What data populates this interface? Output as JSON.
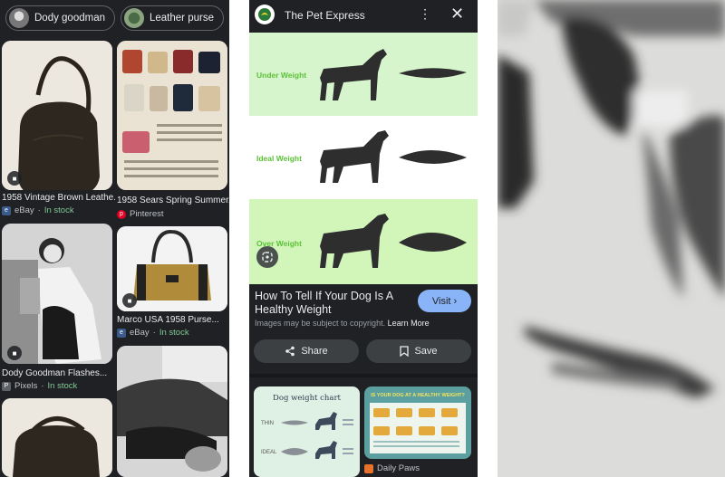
{
  "left_panel": {
    "chips": [
      {
        "label": "Dody goodman"
      },
      {
        "label": "Leather purse"
      },
      {
        "label": ""
      }
    ],
    "results": [
      {
        "caption": "1958 Vintage Brown Leathe...",
        "source": "eBay",
        "stock": "In stock"
      },
      {
        "caption": "1958 Sears Spring Summer...",
        "source": "Pinterest",
        "stock": ""
      },
      {
        "caption": "Marco USA 1958 Purse...",
        "source": "eBay",
        "stock": "In stock"
      },
      {
        "caption": "Dody Goodman Flashes...",
        "source": "Pixels",
        "stock": "In stock"
      }
    ],
    "separator": "·"
  },
  "middle_panel": {
    "header": {
      "title": "The Pet Express",
      "menu_icon": "kebab-icon",
      "close_icon": "close-icon"
    },
    "chart_labels": [
      "Under Weight",
      "Ideal Weight",
      "Over Weight"
    ],
    "image_title": "How To Tell If Your Dog Is A Healthy Weight",
    "visit_label": "Visit",
    "copyright_text": "Images may be subject to copyright.",
    "learn_more": "Learn More",
    "share_label": "Share",
    "save_label": "Save",
    "related": [
      {
        "title": "Dog weight chart",
        "rows": [
          "THIN",
          "IDEAL"
        ]
      },
      {
        "title": "IS YOUR DOG AT A HEALTHY WEIGHT?",
        "source": "Daily Paws"
      }
    ]
  },
  "colors": {
    "dark_bg": "#202124",
    "accent_blue": "#8ab4f8",
    "in_stock_green": "#81c995",
    "chart_green": "#5cc13a"
  }
}
